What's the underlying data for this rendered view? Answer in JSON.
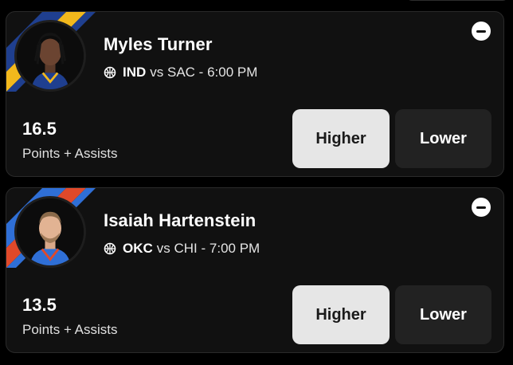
{
  "picks": [
    {
      "player_name": "Myles Turner",
      "team": "IND",
      "opponent_text": "vs SAC - 6:00 PM",
      "line": "16.5",
      "stat": "Points + Assists",
      "higher_label": "Higher",
      "lower_label": "Lower",
      "stripe_colors": [
        "#1f3f8f",
        "#f2b81c"
      ],
      "icons": [
        "basketball-icon",
        "minus-icon"
      ]
    },
    {
      "player_name": "Isaiah Hartenstein",
      "team": "OKC",
      "opponent_text": "vs CHI - 7:00 PM",
      "line": "13.5",
      "stat": "Points + Assists",
      "higher_label": "Higher",
      "lower_label": "Lower",
      "stripe_colors": [
        "#2f6fd6",
        "#e0492a"
      ],
      "icons": [
        "basketball-icon",
        "minus-icon"
      ]
    }
  ]
}
